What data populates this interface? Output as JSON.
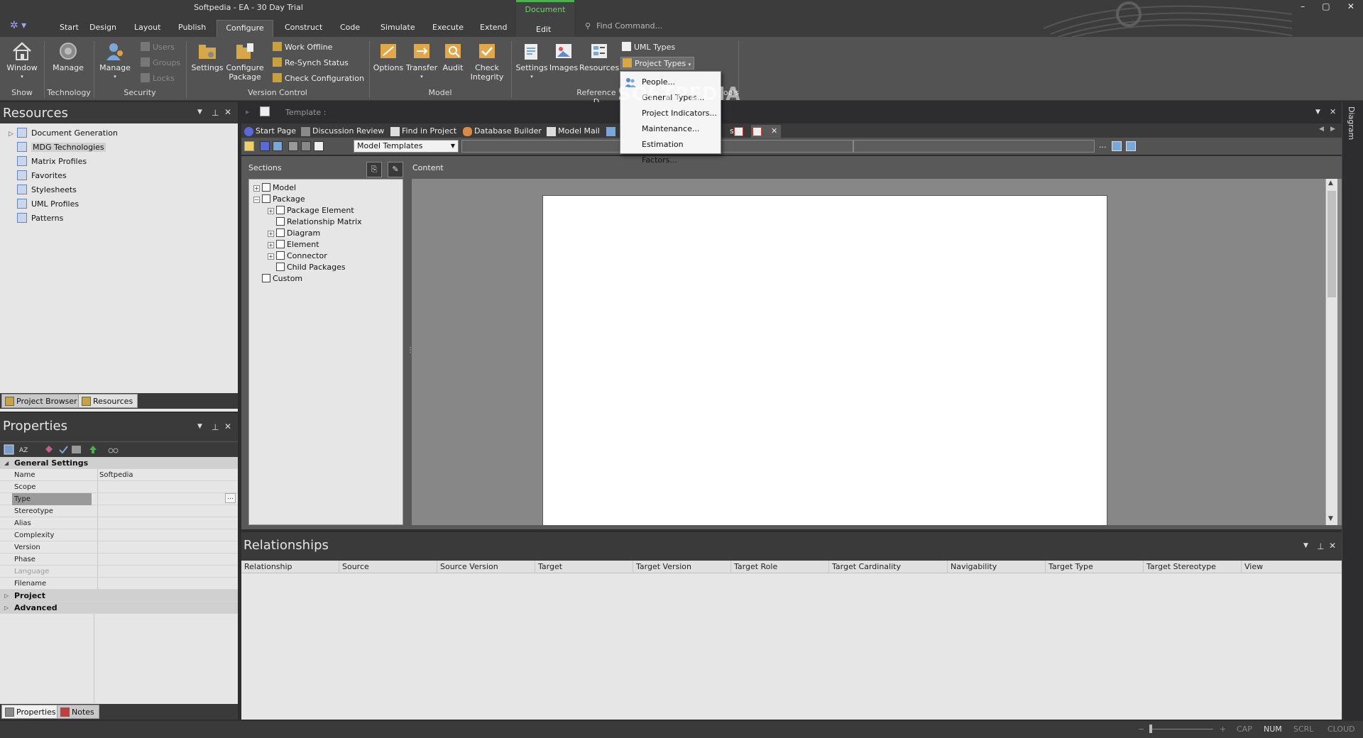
{
  "window": {
    "title": "Softpedia - EA - 30 Day Trial",
    "find_placeholder": "Find Command...",
    "controls": [
      "–",
      "▢",
      "✕"
    ]
  },
  "ribbon_tabs": [
    {
      "label": "Start"
    },
    {
      "label": "Design"
    },
    {
      "label": "Layout"
    },
    {
      "label": "Publish"
    },
    {
      "label": "Configure",
      "active": true
    },
    {
      "label": "Construct"
    },
    {
      "label": "Code"
    },
    {
      "label": "Simulate"
    },
    {
      "label": "Execute"
    },
    {
      "label": "Extend"
    }
  ],
  "context_tab": {
    "group": "Document",
    "label": "Edit"
  },
  "ribbon": {
    "show": {
      "window_label": "Window",
      "group": "Show"
    },
    "technology": {
      "manage_label": "Manage",
      "group": "Technology"
    },
    "security": {
      "manage_label": "Manage",
      "users": "Users",
      "groups": "Groups",
      "locks": "Locks",
      "group": "Security"
    },
    "version_control": {
      "settings": "Settings",
      "configure_package": "Configure Package",
      "work_offline": "Work Offline",
      "resynch": "Re-Synch Status",
      "check_config": "Check Configuration",
      "group": "Version Control"
    },
    "model": {
      "options": "Options",
      "transfer": "Transfer",
      "audit": "Audit",
      "check_integrity": "Check Integrity",
      "group": "Model"
    },
    "reference": {
      "settings": "Settings",
      "images": "Images",
      "resources": "Resources",
      "uml_types": "UML Types",
      "project_types": "Project Types",
      "group_partial": "Reference D",
      "tools_partial": "ools"
    }
  },
  "dropdown": {
    "items": [
      "People...",
      "General Types...",
      "Project Indicators...",
      "Maintenance...",
      "Estimation Factors..."
    ],
    "watermark": "SOFTPEDIA"
  },
  "resources": {
    "title": "Resources",
    "items": [
      {
        "label": "Document Generation"
      },
      {
        "label": "MDG Technologies",
        "selected": true
      },
      {
        "label": "Matrix Profiles"
      },
      {
        "label": "Favorites"
      },
      {
        "label": "Stylesheets"
      },
      {
        "label": "UML Profiles"
      },
      {
        "label": "Patterns"
      }
    ],
    "tabs": [
      "Project Browser",
      "Resources"
    ]
  },
  "properties": {
    "title": "Properties",
    "general": "General Settings",
    "rows": [
      {
        "key": "Name",
        "value": "Softpedia"
      },
      {
        "key": "Scope",
        "value": ""
      },
      {
        "key": "Type",
        "value": ""
      },
      {
        "key": "Stereotype",
        "value": ""
      },
      {
        "key": "Alias",
        "value": ""
      },
      {
        "key": "Complexity",
        "value": ""
      },
      {
        "key": "Version",
        "value": ""
      },
      {
        "key": "Phase",
        "value": ""
      },
      {
        "key": "Language",
        "value": ""
      },
      {
        "key": "Filename",
        "value": ""
      }
    ],
    "project": "Project",
    "advanced": "Advanced",
    "ellipsis": "...",
    "tabs": [
      "Properties",
      "Notes"
    ]
  },
  "center": {
    "template_label": "Template :",
    "doc_tabs": [
      "Start Page",
      "Discussion Review",
      "Find in Project",
      "Database Builder",
      "Model Mail",
      "s"
    ],
    "template_select": "Model Templates",
    "sections_label": "Sections",
    "content_label": "Content",
    "ellipsis": "...",
    "sections": [
      {
        "label": "Model",
        "indent": 0,
        "expander": "+"
      },
      {
        "label": "Package",
        "indent": 0,
        "expander": "−"
      },
      {
        "label": "Package Element",
        "indent": 1,
        "expander": "+"
      },
      {
        "label": "Relationship Matrix",
        "indent": 1,
        "expander": ""
      },
      {
        "label": "Diagram",
        "indent": 1,
        "expander": "+"
      },
      {
        "label": "Element",
        "indent": 1,
        "expander": "+"
      },
      {
        "label": "Connector",
        "indent": 1,
        "expander": "+"
      },
      {
        "label": "Child Packages",
        "indent": 1,
        "expander": ""
      },
      {
        "label": "Custom",
        "indent": 0,
        "expander": ""
      }
    ]
  },
  "relationships": {
    "title": "Relationships",
    "columns": [
      "Relationship",
      "Source",
      "Source Version",
      "Target",
      "Target Version",
      "Target Role",
      "Target Cardinality",
      "Navigability",
      "Target Type",
      "Target Stereotype",
      "View"
    ]
  },
  "right_strip": {
    "label": "Diagram"
  },
  "statusbar": {
    "minus": "−",
    "plus": "+",
    "cap": "CAP",
    "num": "NUM",
    "scrl": "SCRL",
    "cloud": "CLOUD"
  },
  "colors": {
    "context_accent": "#4caf50",
    "panel_bg": "#e6e6e6",
    "dark_bg": "#2d2d30"
  }
}
